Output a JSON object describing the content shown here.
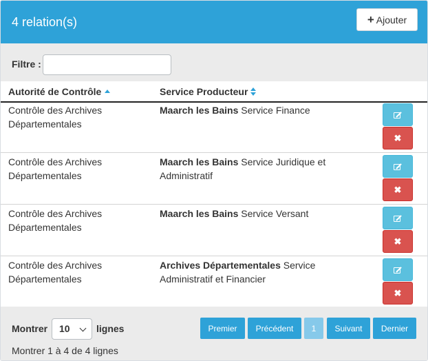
{
  "header": {
    "title": "4 relation(s)",
    "add_button_label": "Ajouter",
    "add_icon": "plus-icon"
  },
  "filter": {
    "label": "Filtre :",
    "value": "",
    "placeholder": ""
  },
  "table": {
    "columns": [
      {
        "label": "Autorité de Contrôle",
        "sort": "ascending"
      },
      {
        "label": "Service Producteur",
        "sort": "sortable"
      }
    ],
    "rows": [
      {
        "authority_line1": "Contrôle des Archives",
        "authority_line2": "Départementales",
        "producer_org": "Maarch les Bains",
        "producer_service_line1": "Service Finance",
        "producer_service_line2": ""
      },
      {
        "authority_line1": "Contrôle des Archives",
        "authority_line2": "Départementales",
        "producer_org": "Maarch les Bains",
        "producer_service_line1": "Service Juridique et",
        "producer_service_line2": "Administratif"
      },
      {
        "authority_line1": "Contrôle des Archives",
        "authority_line2": "Départementales",
        "producer_org": "Maarch les Bains",
        "producer_service_line1": "Service Versant",
        "producer_service_line2": ""
      },
      {
        "authority_line1": "Contrôle des Archives",
        "authority_line2": "Départementales",
        "producer_org": "Archives Départementales",
        "producer_service_line1": "Service",
        "producer_service_line2": "Administratif et Financier"
      }
    ],
    "row_actions": {
      "edit_icon": "edit-icon",
      "delete_icon": "times-icon",
      "delete_glyph": "✖"
    }
  },
  "footer": {
    "show_label": "Montrer",
    "page_size": "10",
    "lines_label": "lignes",
    "info": "Montrer 1 à 4 de 4 lignes",
    "pagination": {
      "first": "Premier",
      "previous": "Précédent",
      "current": "1",
      "next": "Suivant",
      "last": "Dernier"
    }
  },
  "colors": {
    "header_bg": "#2ea2d8",
    "edit_button": "#5bc0de",
    "delete_button": "#d9534f",
    "pagination": "#2ea2d8"
  }
}
